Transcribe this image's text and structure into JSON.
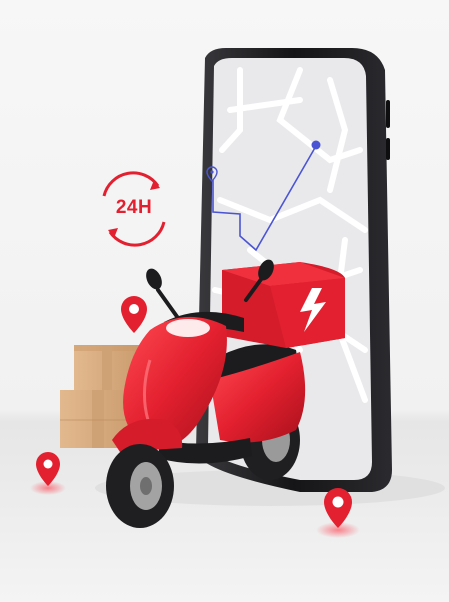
{
  "badge": {
    "label": "24H"
  },
  "colors": {
    "accent_red": "#e3202f",
    "route_line": "#4b55d4",
    "phone_frame": "#1b1b1d",
    "screen": "#e9e9ec",
    "box_tan": "#d8ae84",
    "background": "#f4f4f4"
  },
  "icons": [
    "24h-clock-icon",
    "location-pin-icon",
    "delivery-box-lightning-icon",
    "phone-map-icon",
    "scooter-icon"
  ]
}
